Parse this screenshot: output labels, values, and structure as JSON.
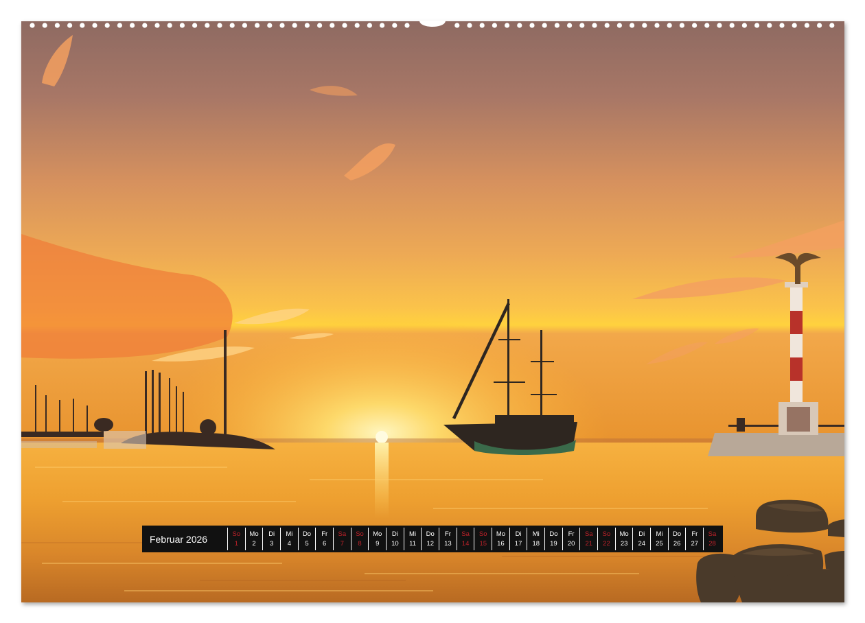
{
  "calendar": {
    "month_label": "Februar 2026",
    "days": [
      {
        "name": "So",
        "date": "1",
        "weekend": true
      },
      {
        "name": "Mo",
        "date": "2",
        "weekend": false
      },
      {
        "name": "Di",
        "date": "3",
        "weekend": false
      },
      {
        "name": "Mi",
        "date": "4",
        "weekend": false
      },
      {
        "name": "Do",
        "date": "5",
        "weekend": false
      },
      {
        "name": "Fr",
        "date": "6",
        "weekend": false
      },
      {
        "name": "Sa",
        "date": "7",
        "weekend": true
      },
      {
        "name": "So",
        "date": "8",
        "weekend": true
      },
      {
        "name": "Mo",
        "date": "9",
        "weekend": false
      },
      {
        "name": "Di",
        "date": "10",
        "weekend": false
      },
      {
        "name": "Mi",
        "date": "11",
        "weekend": false
      },
      {
        "name": "Do",
        "date": "12",
        "weekend": false
      },
      {
        "name": "Fr",
        "date": "13",
        "weekend": false
      },
      {
        "name": "Sa",
        "date": "14",
        "weekend": true
      },
      {
        "name": "So",
        "date": "15",
        "weekend": true
      },
      {
        "name": "Mo",
        "date": "16",
        "weekend": false
      },
      {
        "name": "Di",
        "date": "17",
        "weekend": false
      },
      {
        "name": "Mi",
        "date": "18",
        "weekend": false
      },
      {
        "name": "Do",
        "date": "19",
        "weekend": false
      },
      {
        "name": "Fr",
        "date": "20",
        "weekend": false
      },
      {
        "name": "Sa",
        "date": "21",
        "weekend": true
      },
      {
        "name": "So",
        "date": "22",
        "weekend": true
      },
      {
        "name": "Mo",
        "date": "23",
        "weekend": false
      },
      {
        "name": "Di",
        "date": "24",
        "weekend": false
      },
      {
        "name": "Mi",
        "date": "25",
        "weekend": false
      },
      {
        "name": "Do",
        "date": "26",
        "weekend": false
      },
      {
        "name": "Fr",
        "date": "27",
        "weekend": false
      },
      {
        "name": "Sa",
        "date": "28",
        "weekend": true
      }
    ],
    "colors": {
      "background": "#111111",
      "text": "#ffffff",
      "weekend": "#c0222a"
    }
  },
  "photo": {
    "subject": "sunset-harbor-scene",
    "colors": {
      "sky_top": "#9a6a5a",
      "sky_mid": "#e89a50",
      "horizon": "#ffd040",
      "water": "#f0a030"
    }
  }
}
